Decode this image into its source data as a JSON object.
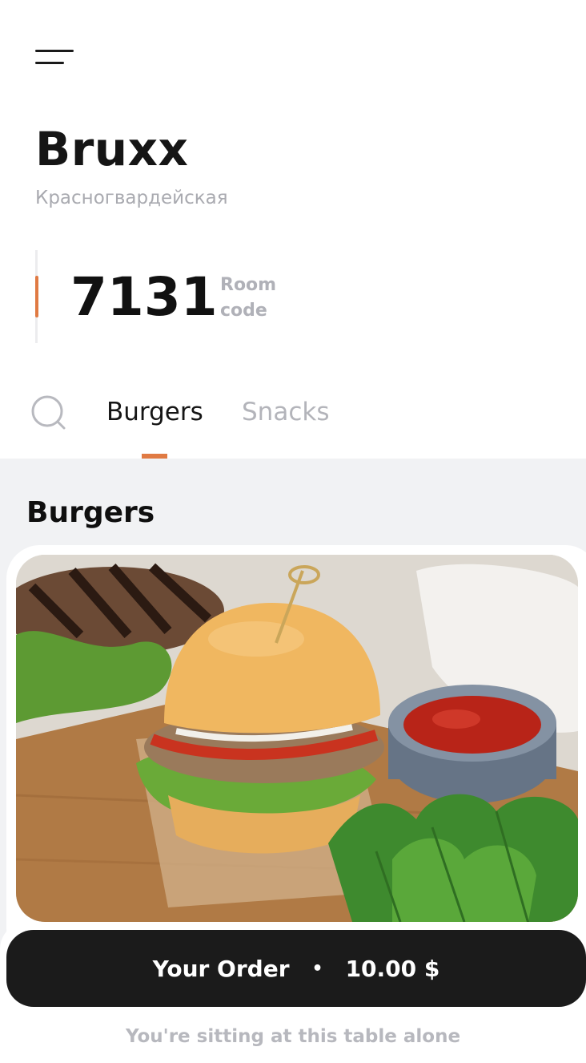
{
  "header": {
    "menu_icon": "hamburger-menu-icon"
  },
  "venue": {
    "name": "Bruxx",
    "location": "Красногвардейская"
  },
  "room": {
    "code": "7131",
    "caption": "Room\ncode"
  },
  "tabs": {
    "search_icon": "search-icon",
    "items": [
      {
        "label": "Burgers",
        "active": true
      },
      {
        "label": "Snacks",
        "active": false
      }
    ]
  },
  "section": {
    "title": "Burgers"
  },
  "order": {
    "label": "Your Order",
    "separator": "•",
    "total": "10.00 $"
  },
  "footer": {
    "note": "You're sitting at this table alone"
  },
  "colors": {
    "accent": "#e07a43",
    "dark": "#1b1b1b",
    "muted": "#b0b1b8",
    "section_bg": "#f1f2f4"
  }
}
